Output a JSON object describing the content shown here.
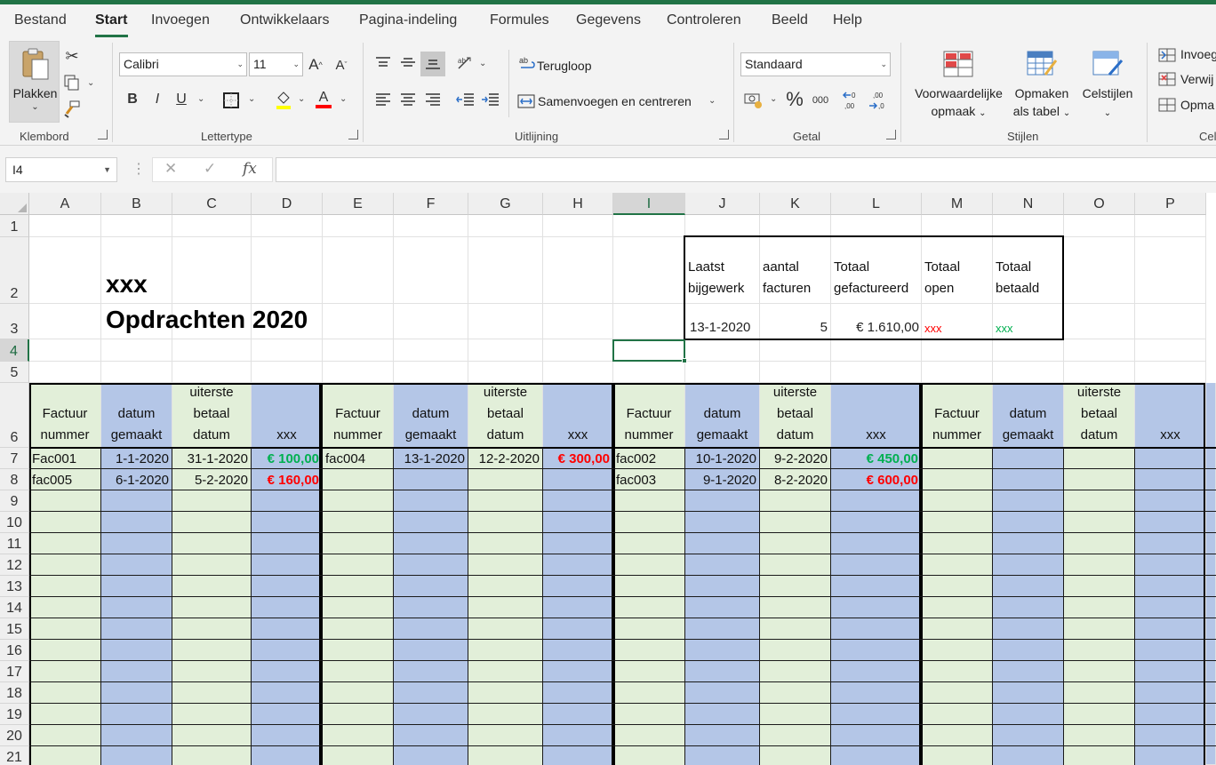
{
  "ribbon_tabs": [
    {
      "label": "Bestand",
      "active": false
    },
    {
      "label": "Start",
      "active": true
    },
    {
      "label": "Invoegen",
      "active": false
    },
    {
      "label": "Ontwikkelaars",
      "active": false
    },
    {
      "label": "Pagina-indeling",
      "active": false
    },
    {
      "label": "Formules",
      "active": false
    },
    {
      "label": "Gegevens",
      "active": false
    },
    {
      "label": "Controleren",
      "active": false
    },
    {
      "label": "Beeld",
      "active": false
    },
    {
      "label": "Help",
      "active": false
    }
  ],
  "ribbon": {
    "clipboard": {
      "paste_label": "Plakken",
      "group_label": "Klembord"
    },
    "font": {
      "font_name": "Calibri",
      "font_size": "11",
      "group_label": "Lettertype",
      "bold": "B",
      "italic": "I",
      "underline": "U",
      "font_color": "#ff0000",
      "fill_color": "#ffff00"
    },
    "alignment": {
      "wrap_label": "Terugloop",
      "merge_label": "Samenvoegen en centreren",
      "group_label": "Uitlijning"
    },
    "number": {
      "format": "Standaard",
      "group_label": "Getal",
      "percent": "%",
      "thousands": "000"
    },
    "styles": {
      "cond_format_label_1": "Voorwaardelijke",
      "cond_format_label_2": "opmaak",
      "table_label_1": "Opmaken",
      "table_label_2": "als tabel",
      "cell_styles_label": "Celstijlen",
      "group_label": "Stijlen"
    },
    "cells": {
      "insert_label": "Invoeg",
      "delete_label": "Verwij",
      "format_label": "Opma",
      "group_label": "Cel"
    }
  },
  "formula_bar": {
    "name_box": "I4",
    "cancel_icon": "✕",
    "enter_icon": "✓",
    "fx_label": "fx",
    "formula": ""
  },
  "columns": [
    "A",
    "B",
    "C",
    "D",
    "E",
    "F",
    "G",
    "H",
    "I",
    "J",
    "K",
    "L",
    "M",
    "N",
    "O",
    "P"
  ],
  "selected_column": "I",
  "rows": [
    "1",
    "2",
    "3",
    "4",
    "5",
    "6",
    "7",
    "8",
    "9",
    "10",
    "11",
    "12",
    "13",
    "14",
    "15",
    "16",
    "17",
    "18",
    "19",
    "20",
    "21"
  ],
  "selected_row": "4",
  "titles": {
    "line1": "xxx",
    "line2": "Opdrachten 2020"
  },
  "summary": {
    "headers": [
      {
        "l1": "Laatst",
        "l2": "bijgewerk"
      },
      {
        "l1": "aantal",
        "l2": "facturen"
      },
      {
        "l1": "Totaal",
        "l2": "gefactureerd"
      },
      {
        "l1": "Totaal",
        "l2": "open"
      },
      {
        "l1": "Totaal",
        "l2": "betaald"
      }
    ],
    "values": [
      "13-1-2020",
      "5",
      "€ 1.610,00",
      "xxx",
      "xxx"
    ],
    "open_color": "#ff0000",
    "paid_color": "#00b050"
  },
  "table_headers": [
    {
      "l1": "",
      "l2": "Factuur",
      "l3": "nummer"
    },
    {
      "l1": "",
      "l2": "datum",
      "l3": "gemaakt"
    },
    {
      "l1": "uiterste",
      "l2": "betaal",
      "l3": "datum"
    },
    {
      "l1": "",
      "l2": "",
      "l3": "xxx"
    },
    {
      "l1": "",
      "l2": "Factuur",
      "l3": "nummer"
    },
    {
      "l1": "",
      "l2": "datum",
      "l3": "gemaakt"
    },
    {
      "l1": "uiterste",
      "l2": "betaal",
      "l3": "datum"
    },
    {
      "l1": "",
      "l2": "",
      "l3": "xxx"
    },
    {
      "l1": "",
      "l2": "Factuur",
      "l3": "nummer"
    },
    {
      "l1": "",
      "l2": "datum",
      "l3": "gemaakt"
    },
    {
      "l1": "uiterste",
      "l2": "betaal",
      "l3": "datum"
    },
    {
      "l1": "",
      "l2": "",
      "l3": "xxx"
    },
    {
      "l1": "",
      "l2": "Factuur",
      "l3": "nummer"
    },
    {
      "l1": "",
      "l2": "datum",
      "l3": "gemaakt"
    },
    {
      "l1": "uiterste",
      "l2": "betaal",
      "l3": "datum"
    },
    {
      "l1": "",
      "l2": "",
      "l3": "xxx"
    }
  ],
  "data_rows": [
    [
      "Fac001",
      "1-1-2020",
      "31-1-2020",
      "€ 100,00",
      "fac004",
      "13-1-2020",
      "12-2-2020",
      "€ 300,00",
      "fac002",
      "10-1-2020",
      "9-2-2020",
      "€ 450,00",
      "",
      "",
      "",
      ""
    ],
    [
      "fac005",
      "6-1-2020",
      "5-2-2020",
      "€ 160,00",
      "",
      "",
      "",
      "",
      "fac003",
      "9-1-2020",
      "8-2-2020",
      "€ 600,00",
      "",
      "",
      "",
      ""
    ]
  ],
  "amount_colors": [
    [
      "",
      "",
      "",
      "#00b050",
      "",
      "",
      "",
      "#ff0000",
      "",
      "",
      "",
      "#00b050",
      "",
      "",
      "",
      ""
    ],
    [
      "",
      "",
      "",
      "#ff0000",
      "",
      "",
      "",
      "",
      "",
      "",
      "",
      "#ff0000",
      "",
      "",
      "",
      ""
    ]
  ],
  "colors": {
    "accent": "#217346",
    "green_fill": "#e2efd9",
    "blue_fill": "#b4c6e7"
  }
}
